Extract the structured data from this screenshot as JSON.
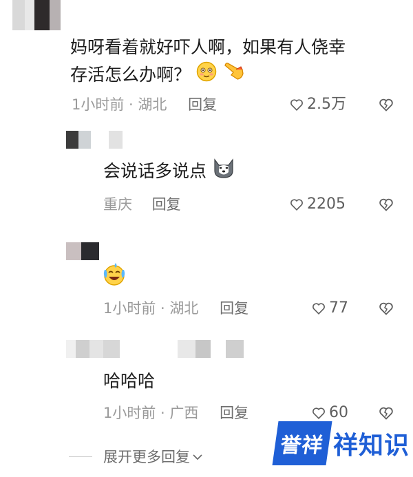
{
  "comments": [
    {
      "text_line1": "妈呀看着就好吓人啊，如果有人侥幸",
      "text_line2": "存活怎么办啊？",
      "emojis": [
        "blushing-emoji",
        "pointing-hand-emoji"
      ],
      "time": "1小时前",
      "location": "湖北",
      "reply_label": "回复",
      "likes": "2.5万"
    },
    {
      "text": "会说话多说点",
      "emojis": [
        "husky-dog-emoji"
      ],
      "location": "重庆",
      "reply_label": "回复",
      "likes": "2205"
    },
    {
      "text": "",
      "emojis": [
        "laughing-crying-emoji"
      ],
      "time": "1小时前",
      "location": "湖北",
      "reply_label": "回复",
      "likes": "77"
    },
    {
      "text": "哈哈哈",
      "time": "1小时前",
      "location": "广西",
      "reply_label": "回复",
      "likes": "60"
    }
  ],
  "expand_replies": "展开更多回复",
  "watermark": {
    "logo": "誉祥",
    "text": "祥知识"
  },
  "colors": {
    "text": "#1c1c1c",
    "meta": "#9a9a9a",
    "watermark": "#1f5fd6"
  }
}
